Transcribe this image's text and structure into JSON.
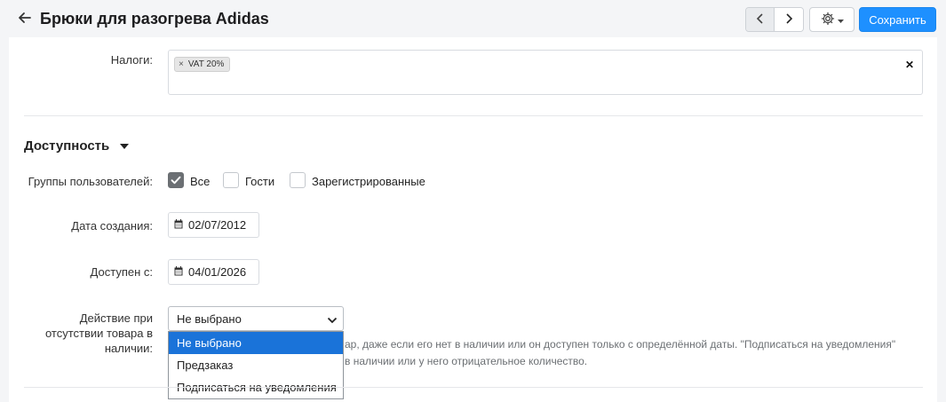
{
  "header": {
    "title": "Брюки для разогрева Adidas",
    "save_label": "Сохранить",
    "icons": {
      "back": "arrow-left-icon",
      "prev": "chevron-left-icon",
      "next": "chevron-right-icon",
      "settings": "gear-icon"
    }
  },
  "taxes": {
    "label": "Налоги:",
    "chips": [
      "VAT 20%"
    ],
    "clear_icon": "close-icon"
  },
  "availability": {
    "section_title": "Доступность",
    "user_groups": {
      "label": "Группы пользователей:",
      "options": [
        {
          "label": "Все",
          "checked": true
        },
        {
          "label": "Гости",
          "checked": false
        },
        {
          "label": "Зарегистрированные",
          "checked": false
        }
      ]
    },
    "created_date": {
      "label": "Дата создания:",
      "value": "02/07/2012"
    },
    "available_from": {
      "label": "Доступен с:",
      "value": "04/01/2026"
    },
    "out_of_stock_action": {
      "label_lines": [
        "Действие при",
        "отсутствии товара в",
        "наличии:"
      ],
      "selected": "Не выбрано",
      "options": [
        "Не выбрано",
        "Предзаказ",
        "Подписаться на уведомления"
      ],
      "help_lines": [
        "ар, даже если его нет в наличии или он доступен только с определённой даты. \"Подписаться на уведомления\"",
        "в наличии или у него отрицательное количество."
      ]
    }
  }
}
